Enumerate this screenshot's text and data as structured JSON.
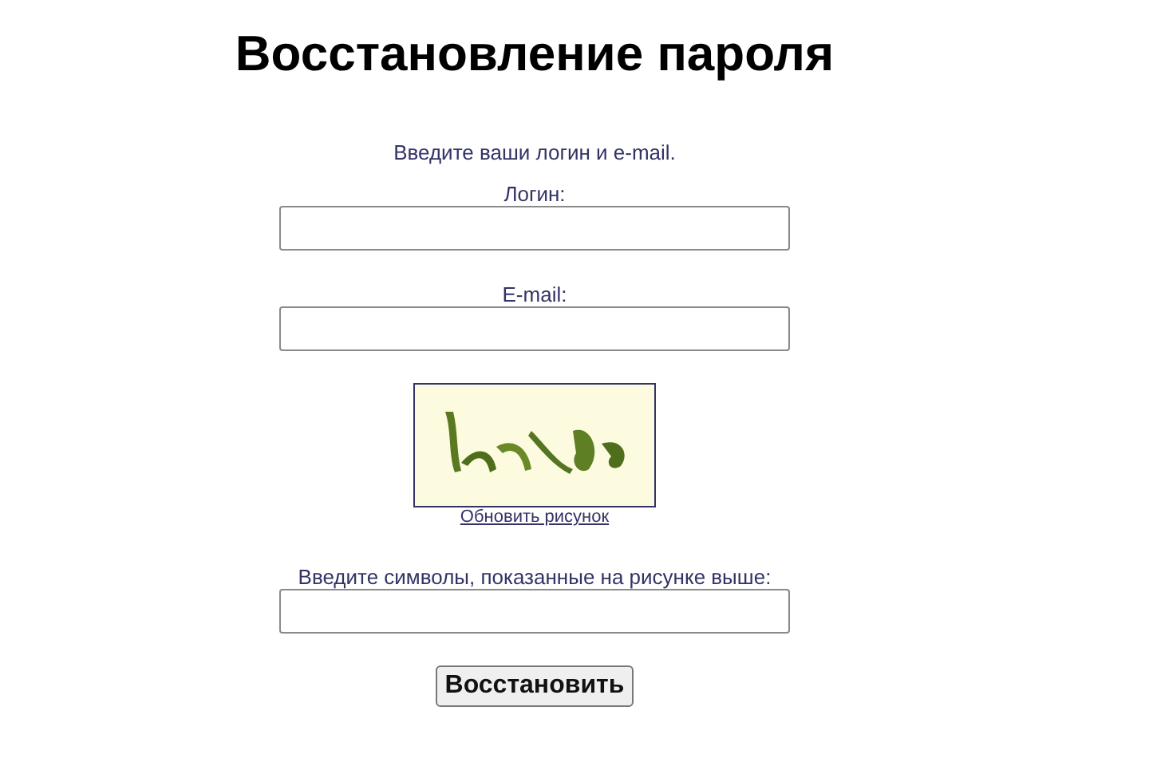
{
  "title": "Восстановление пароля",
  "intro": "Введите ваши логин и e-mail.",
  "fields": [
    {
      "label": "Логин:"
    },
    {
      "label": "E-mail:"
    }
  ],
  "captcha": {
    "kind": "picture",
    "refresh_link": "Обновить рисунок",
    "label": "Введите символы, показанные на рисунке выше:"
  },
  "submit": "Восстановить"
}
